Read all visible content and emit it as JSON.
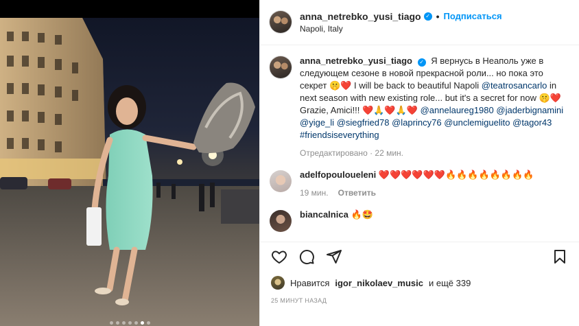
{
  "post": {
    "username": "anna_netrebko_yusi_tiago",
    "follow_label": "Подписаться",
    "separator": "•",
    "location": "Napoli, Italy"
  },
  "caption": {
    "username": "anna_netrebko_yusi_tiago",
    "text_ru": "Я вернусь в Неаполь уже в следующем сезоне в новой прекрасной роли... но пока это секрет 🤫❤️",
    "text_en_1": "I will be back to beautiful Napoli",
    "mention_1": "@teatrosancarlo",
    "text_en_2": "in next season with new existing role... but it's a secret for now 🤫❤️ Grazie, Amici!!! ❤️🙏❤️🙏❤️",
    "mentions_2": [
      "@annelaureg1980",
      "@jaderbignamini",
      "@yige_li",
      "@siegfried78",
      "@laprincy76",
      "@unclemiguelito",
      "@tagor43"
    ],
    "hashtag": "#friendsiseverything",
    "meta": "Отредактировано · 22 мин."
  },
  "comments": [
    {
      "username": "adelfopoulouelenі",
      "text": "❤️❤️❤️❤️❤️❤️🔥🔥🔥🔥🔥🔥🔥🔥",
      "time": "19 мин.",
      "reply_label": "Ответить"
    },
    {
      "username": "biancalnica",
      "text": "🔥🤩"
    }
  ],
  "actions": {
    "like_icon": "heart-icon",
    "comment_icon": "comment-icon",
    "share_icon": "share-icon",
    "save_icon": "bookmark-icon"
  },
  "likes": {
    "prefix": "Нравится",
    "user": "igor_nikolaev_music",
    "suffix": "и ещё 339"
  },
  "timestamp": "25 МИНУТ НАЗАД",
  "carousel": {
    "total": 7,
    "active": 5
  },
  "colors": {
    "accent": "#0095f6",
    "text": "#262626",
    "muted": "#8e8e8e",
    "mention": "#00376b"
  }
}
